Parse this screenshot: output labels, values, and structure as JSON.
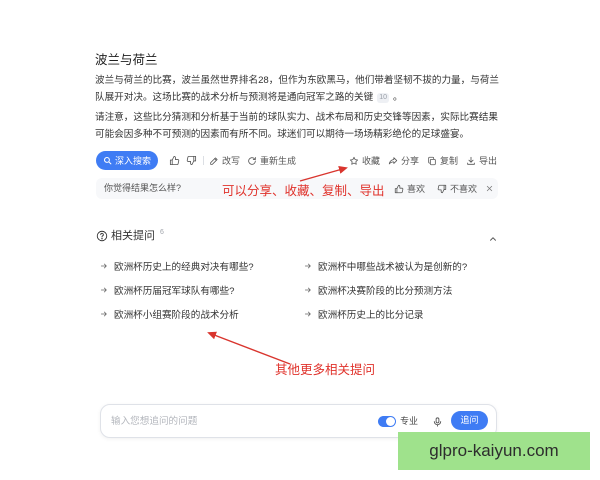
{
  "answer": {
    "title": "波兰与荷兰",
    "paragraph1": "波兰与荷兰的比赛，波兰虽然世界排名28，但作为东欧黑马，他们带着坚韧不拔的力量，与荷兰队展开对决。这场比赛的战术分析与预测将是通向冠军之路的关键",
    "citation": "10",
    "paragraph1_end": "。",
    "paragraph2": "请注意，这些比分猜测和分析基于当前的球队实力、战术布局和历史交锋等因素，实际比赛结果可能会因多种不可预测的因素而有所不同。球迷们可以期待一场场精彩绝伦的足球盛宴。"
  },
  "toolbar": {
    "deep_search_label": "深入搜索",
    "rewrite_label": "改写",
    "regenerate_label": "重新生成",
    "favorite_label": "收藏",
    "share_label": "分享",
    "copy_label": "复制",
    "export_label": "导出"
  },
  "feedback": {
    "prompt": "你觉得结果怎么样?",
    "like_label": "喜欢",
    "dislike_label": "不喜欢"
  },
  "related": {
    "title": "相关提问",
    "count": "6",
    "items": [
      "欧洲杯历史上的经典对决有哪些?",
      "欧洲杯中哪些战术被认为是创新的?",
      "欧洲杯历届冠军球队有哪些?",
      "欧洲杯决赛阶段的比分预测方法",
      "欧洲杯小组赛阶段的战术分析",
      "欧洲杯历史上的比分记录"
    ]
  },
  "input": {
    "placeholder": "输入您想追问的问题",
    "pro_toggle_label": "专业",
    "pro_toggle_on": true,
    "submit_label": "追问"
  },
  "annotations": {
    "toolbar_note": "可以分享、收藏、复制、导出",
    "related_note": "其他更多相关提问"
  },
  "watermark": {
    "text": "glpro-kaiyun.com"
  },
  "colors": {
    "accent_blue": "#3f7cf4",
    "annotation_red": "#e0322b",
    "watermark_green": "#9fe28c",
    "feedback_background": "#f7f8fa"
  },
  "icons": {
    "deep_search": "search-icon",
    "like": "thumbs-up-icon",
    "dislike": "thumbs-down-icon",
    "rewrite": "edit-icon",
    "regenerate": "refresh-icon",
    "favorite": "star-icon",
    "share": "share-icon",
    "copy": "copy-icon",
    "export": "download-icon",
    "feedback_close": "close-icon",
    "related_header": "question-circle-icon",
    "related_collapse": "chevron-up-icon",
    "related_item": "arrow-right-icon",
    "voice_input": "microphone-icon"
  }
}
